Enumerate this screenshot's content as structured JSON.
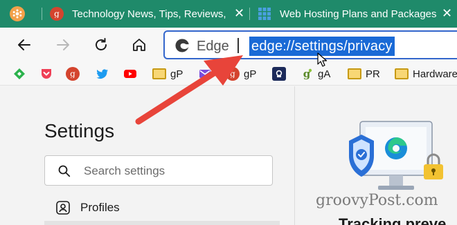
{
  "tabs": [
    {
      "title": "Technology News, Tips, Reviews,",
      "favicon": "groovypost-g-icon",
      "active": false
    },
    {
      "title": "Web Hosting Plans and Packages",
      "favicon": "grid-icon",
      "active": false
    }
  ],
  "toolbar": {
    "browser_label": "Edge",
    "url": "edge://settings/privacy"
  },
  "favorites": [
    {
      "label": "",
      "icon": "feedly-icon"
    },
    {
      "label": "",
      "icon": "pocket-icon"
    },
    {
      "label": "",
      "icon": "groovypost-icon"
    },
    {
      "label": "",
      "icon": "twitter-icon"
    },
    {
      "label": "",
      "icon": "youtube-icon"
    },
    {
      "label": "gP",
      "icon": "folder-icon"
    },
    {
      "label": "",
      "icon": "mail-icon"
    },
    {
      "label": "gP",
      "icon": "groovypost-icon"
    },
    {
      "label": "",
      "icon": "password-icon"
    },
    {
      "label": "gA",
      "icon": "groovyandroid-icon"
    },
    {
      "label": "PR",
      "icon": "folder-icon"
    },
    {
      "label": "Hardware",
      "icon": "folder-icon"
    }
  ],
  "settings": {
    "title": "Settings",
    "search_placeholder": "Search settings",
    "nav": [
      {
        "label": "Profiles",
        "icon": "profile-icon"
      }
    ]
  },
  "right_panel": {
    "watermark": "groovyPost.com",
    "heading": "Tracking preve"
  },
  "colors": {
    "tabstrip": "#1f8a6a",
    "url_highlight": "#1a6ad6",
    "address_border": "#3366cc",
    "arrow": "#e8443a"
  }
}
